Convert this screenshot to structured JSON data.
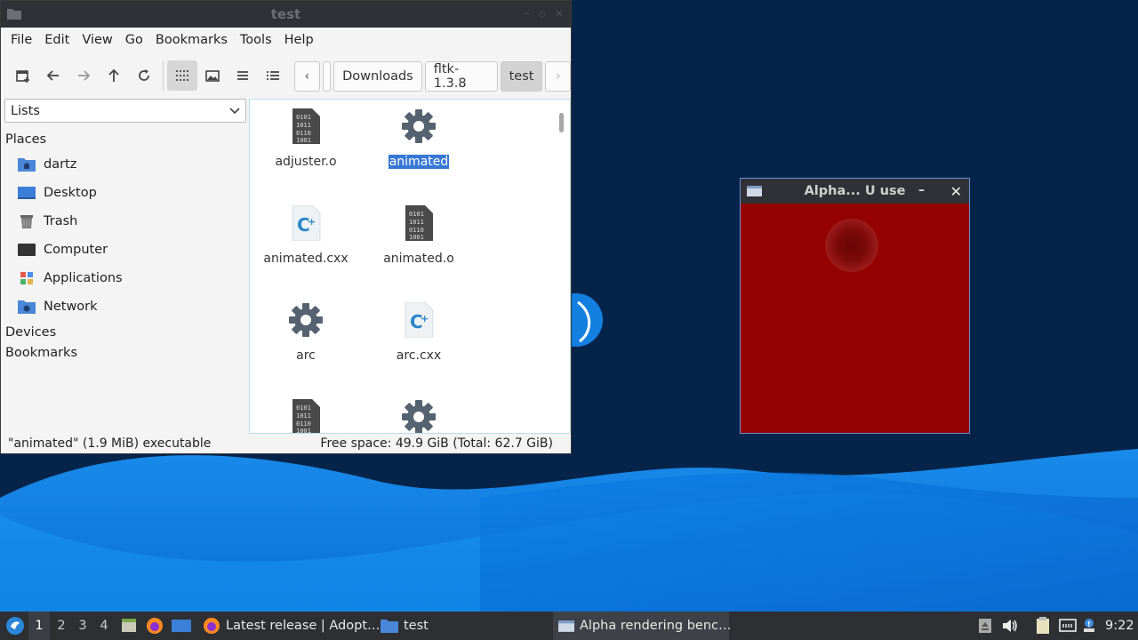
{
  "file_manager": {
    "title": "test",
    "menu": [
      "File",
      "Edit",
      "View",
      "Go",
      "Bookmarks",
      "Tools",
      "Help"
    ],
    "path": [
      "Downloads",
      "fltk-1.3.8",
      "test"
    ],
    "side_pane_mode": "Lists",
    "sidebar": {
      "places_header": "Places",
      "items": [
        {
          "label": "dartz",
          "icon": "home-folder-icon"
        },
        {
          "label": "Desktop",
          "icon": "desktop-icon"
        },
        {
          "label": "Trash",
          "icon": "trash-icon"
        },
        {
          "label": "Computer",
          "icon": "computer-icon"
        },
        {
          "label": "Applications",
          "icon": "applications-icon"
        },
        {
          "label": "Network",
          "icon": "network-icon"
        }
      ],
      "devices_header": "Devices",
      "bookmarks_header": "Bookmarks"
    },
    "files": [
      {
        "name": "adjuster.o",
        "type": "binary"
      },
      {
        "name": "animated",
        "type": "executable",
        "selected": true
      },
      {
        "name": "animated.cxx",
        "type": "cpp"
      },
      {
        "name": "animated.o",
        "type": "binary"
      },
      {
        "name": "arc",
        "type": "executable"
      },
      {
        "name": "arc.cxx",
        "type": "cpp"
      },
      {
        "name": "",
        "type": "binary"
      },
      {
        "name": "",
        "type": "executable"
      }
    ],
    "status_left": "\"animated\" (1.9 MiB) executable",
    "status_right": "Free space: 49.9 GiB (Total: 62.7 GiB)"
  },
  "alpha_window": {
    "title": "Alpha...  U use",
    "background": "#950000"
  },
  "taskbar": {
    "workspaces": [
      "1",
      "2",
      "3",
      "4"
    ],
    "tasks": [
      {
        "label": "Latest release | Adopt…",
        "icon": "firefox-icon"
      },
      {
        "label": "test",
        "icon": "folder-icon"
      },
      {
        "label": "Alpha rendering benc…",
        "icon": "window-icon"
      }
    ],
    "clock": "9:22"
  },
  "colors": {
    "accent": "#3778d6",
    "titlebar": "#2f3136",
    "taskbar": "#2d2f33",
    "desktop": "#06244a"
  }
}
